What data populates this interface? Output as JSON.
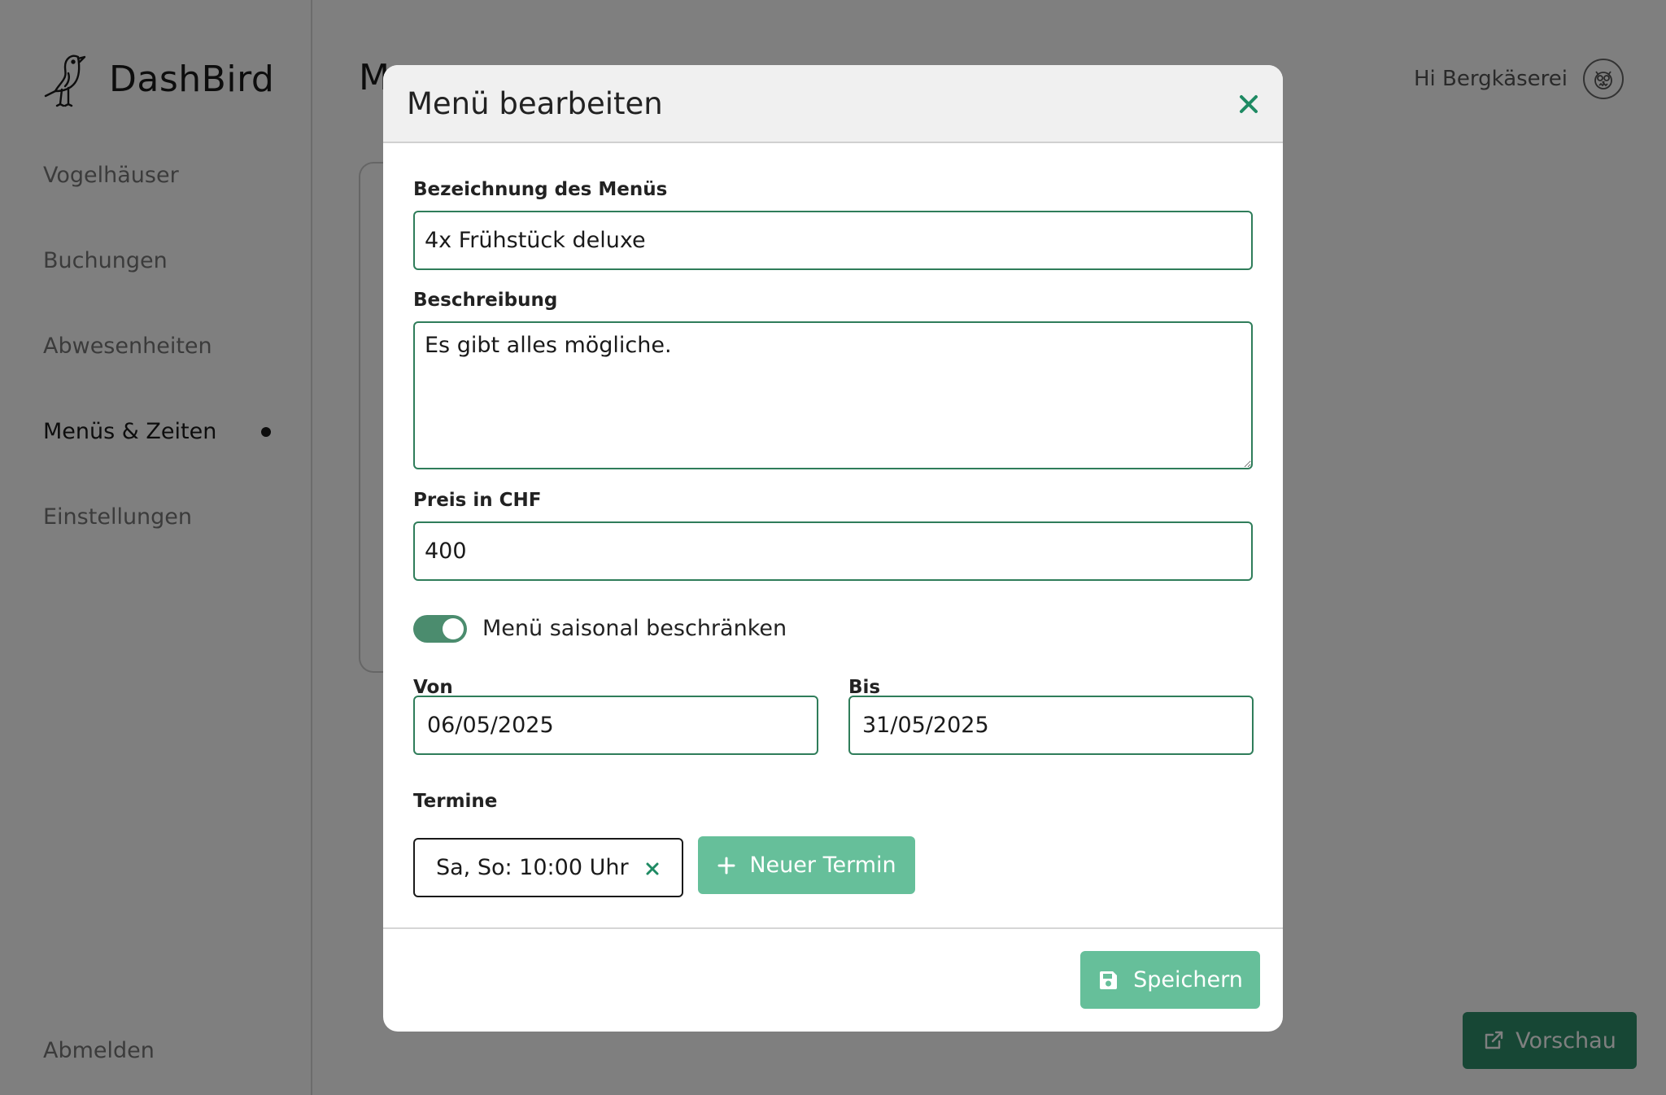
{
  "app": {
    "name": "DashBird",
    "page_title_partial": "M",
    "greeting": "Hi Bergkäserei",
    "preview_label": "Vorschau",
    "logout_label": "Abmelden"
  },
  "sidebar": {
    "items": [
      {
        "label": "Vogelhäuser",
        "active": false
      },
      {
        "label": "Buchungen",
        "active": false
      },
      {
        "label": "Abwesenheiten",
        "active": false
      },
      {
        "label": "Menüs & Zeiten",
        "active": true
      },
      {
        "label": "Einstellungen",
        "active": false
      }
    ]
  },
  "modal": {
    "title": "Menü bearbeiten",
    "name_label": "Bezeichnung des Menüs",
    "name_value": "4x Frühstück deluxe",
    "description_label": "Beschreibung",
    "description_value": "Es gibt alles mögliche.",
    "price_label": "Preis in CHF",
    "price_value": "400",
    "seasonal_toggle_label": "Menü saisonal beschränken",
    "seasonal_toggle_on": true,
    "from_label": "Von",
    "from_value": "06/05/2025",
    "to_label": "Bis",
    "to_value": "31/05/2025",
    "terms_label": "Termine",
    "terms": [
      {
        "label": "Sa, So: 10:00 Uhr"
      }
    ],
    "new_term_label": "Neuer Termin",
    "save_label": "Speichern"
  },
  "colors": {
    "accent": "#2f7d5a",
    "button_light": "#66bf9a",
    "button_dark": "#2e8f6b",
    "overlay": "rgba(0,0,0,0.5)"
  },
  "icons": {
    "logo": "bird-icon",
    "avatar": "owl-icon",
    "close": "close-icon",
    "chip_remove": "close-icon",
    "new_term": "plus-icon",
    "save": "floppy-disk-icon",
    "preview": "external-link-icon"
  }
}
